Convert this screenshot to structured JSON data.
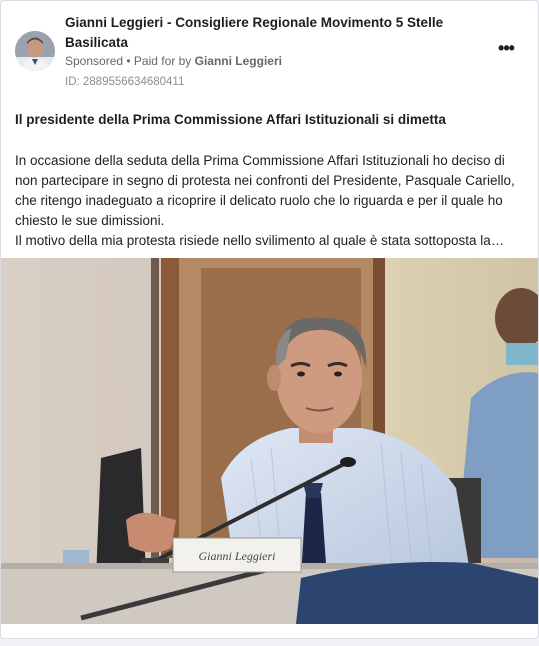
{
  "ad": {
    "page_name": "Gianni Leggieri - Consigliere Regionale Movimento 5 Stelle Basilicata",
    "sponsored_label": "Sponsored",
    "paid_for_prefix": " • Paid for by ",
    "payer": "Gianni Leggieri",
    "id_label": "ID: 2889556634680411",
    "more_icon": "more-horizontal-icon"
  },
  "content": {
    "headline": "Il presidente della Prima Commissione Affari Istituzionali si dimetta",
    "paragraph_1": "In occasione della seduta della Prima Commissione Affari Istituzionali ho deciso di non partecipare in segno di protesta nei confronti del Presidente, Pasquale Cariello, che ritengo inadeguato a ricoprire il delicato ruolo che lo riguarda e per il quale ho chiesto le sue dimissioni.",
    "paragraph_2": "Il motivo della mia protesta risiede nello svilimento al quale è stata sottoposta la…"
  },
  "photo": {
    "nameplate_text": "Gianni Leggieri"
  },
  "colors": {
    "card_background": "#ffffff",
    "page_background": "#f0f2f5",
    "text_primary": "#1c1e21",
    "text_secondary": "#65676b"
  }
}
